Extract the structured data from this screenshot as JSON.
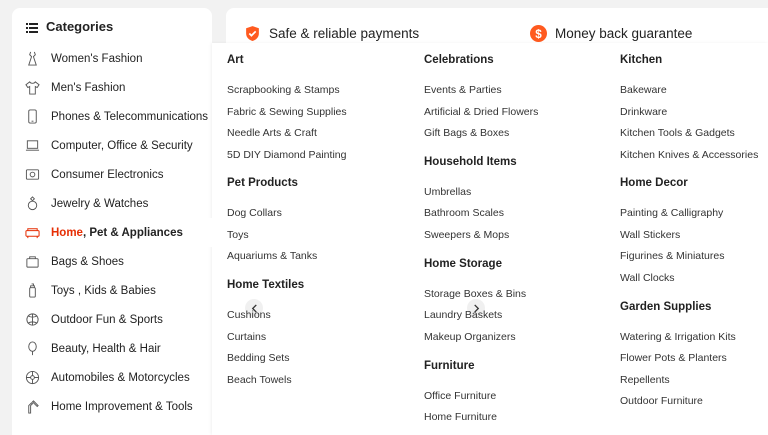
{
  "sidebar": {
    "title": "Categories",
    "items": [
      {
        "label": "Women's Fashion",
        "icon": "dress-icon"
      },
      {
        "label": "Men's Fashion",
        "icon": "shirt-icon"
      },
      {
        "label": "Phones & Telecommunications",
        "icon": "phone-icon"
      },
      {
        "label": "Computer, Office & Security",
        "icon": "laptop-icon"
      },
      {
        "label": "Consumer Electronics",
        "icon": "camera-icon"
      },
      {
        "label": "Jewelry & Watches",
        "icon": "ring-icon"
      },
      {
        "label_a": "Home",
        "label_b": ", Pet & Appliances",
        "icon": "sofa-icon",
        "active": true
      },
      {
        "label": "Bags & Shoes",
        "icon": "bag-icon"
      },
      {
        "label": "Toys , Kids & Babies",
        "icon": "bottle-icon"
      },
      {
        "label": "Outdoor Fun & Sports",
        "icon": "ball-icon"
      },
      {
        "label": "Beauty, Health & Hair",
        "icon": "mirror-icon"
      },
      {
        "label": "Automobiles & Motorcycles",
        "icon": "wheel-icon"
      },
      {
        "label": "Home Improvement & Tools",
        "icon": "tools-icon"
      }
    ]
  },
  "banner": {
    "payments": "Safe & reliable payments",
    "guarantee": "Money back guarantee"
  },
  "colors": {
    "accent": "#e62e04",
    "badge_orange": "#ff5a1f"
  },
  "menu": {
    "col1": {
      "art_title": "Art",
      "art": [
        "Scrapbooking & Stamps",
        "Fabric & Sewing Supplies",
        "Needle Arts & Craft",
        "5D DIY Diamond Painting"
      ],
      "pet_title": "Pet Products",
      "pet": [
        "Dog Collars",
        "Toys",
        "Aquariums & Tanks"
      ],
      "textiles_title": "Home Textiles",
      "textiles": [
        "Cushions",
        "Curtains",
        "Bedding Sets",
        "Beach Towels"
      ]
    },
    "col2": {
      "celebrations_title": "Celebrations",
      "celebrations": [
        "Events & Parties",
        "Artificial & Dried Flowers",
        "Gift Bags & Boxes"
      ],
      "household_title": "Household Items",
      "household": [
        "Umbrellas",
        "Bathroom Scales",
        "Sweepers & Mops"
      ],
      "storage_title": "Home Storage",
      "storage": [
        "Storage Boxes & Bins",
        "Laundry Baskets",
        "Makeup Organizers"
      ],
      "furniture_title": "Furniture",
      "furniture": [
        "Office Furniture",
        "Home Furniture"
      ]
    },
    "col3": {
      "kitchen_title": "Kitchen",
      "kitchen": [
        "Bakeware",
        "Drinkware",
        "Kitchen Tools & Gadgets",
        "Kitchen Knives & Accessories"
      ],
      "decor_title": "Home Decor",
      "decor": [
        "Painting & Calligraphy",
        "Wall Stickers",
        "Figurines & Miniatures",
        "Wall Clocks"
      ],
      "garden_title": "Garden Supplies",
      "garden": [
        "Watering & Irrigation Kits",
        "Flower Pots & Planters",
        "Repellents",
        "Outdoor Furniture"
      ]
    }
  }
}
